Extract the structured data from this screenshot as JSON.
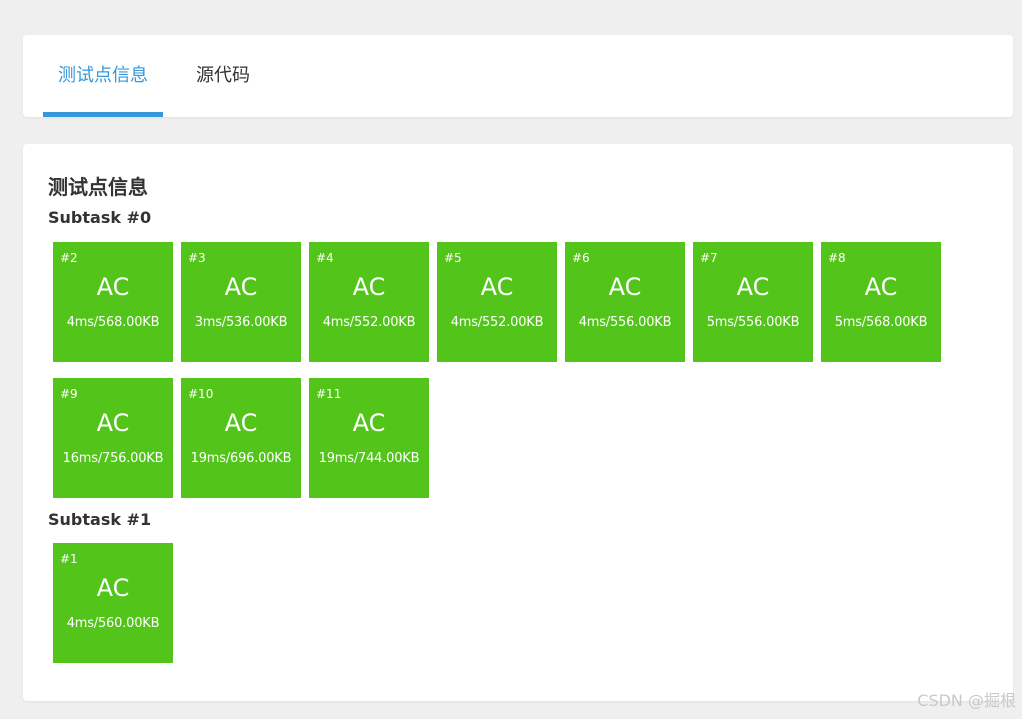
{
  "tabs": [
    {
      "label": "测试点信息",
      "active": true
    },
    {
      "label": "源代码",
      "active": false
    }
  ],
  "section_title": "测试点信息",
  "status_color": "#52c41a",
  "accent_color": "#3498db",
  "subtasks": [
    {
      "title": "Subtask #0",
      "cases": [
        {
          "id": "#2",
          "result": "AC",
          "stat": "4ms/568.00KB"
        },
        {
          "id": "#3",
          "result": "AC",
          "stat": "3ms/536.00KB"
        },
        {
          "id": "#4",
          "result": "AC",
          "stat": "4ms/552.00KB"
        },
        {
          "id": "#5",
          "result": "AC",
          "stat": "4ms/552.00KB"
        },
        {
          "id": "#6",
          "result": "AC",
          "stat": "4ms/556.00KB"
        },
        {
          "id": "#7",
          "result": "AC",
          "stat": "5ms/556.00KB"
        },
        {
          "id": "#8",
          "result": "AC",
          "stat": "5ms/568.00KB"
        },
        {
          "id": "#9",
          "result": "AC",
          "stat": "16ms/756.00KB"
        },
        {
          "id": "#10",
          "result": "AC",
          "stat": "19ms/696.00KB"
        },
        {
          "id": "#11",
          "result": "AC",
          "stat": "19ms/744.00KB"
        }
      ]
    },
    {
      "title": "Subtask #1",
      "cases": [
        {
          "id": "#1",
          "result": "AC",
          "stat": "4ms/560.00KB"
        }
      ]
    }
  ],
  "watermark": "CSDN @掘根"
}
